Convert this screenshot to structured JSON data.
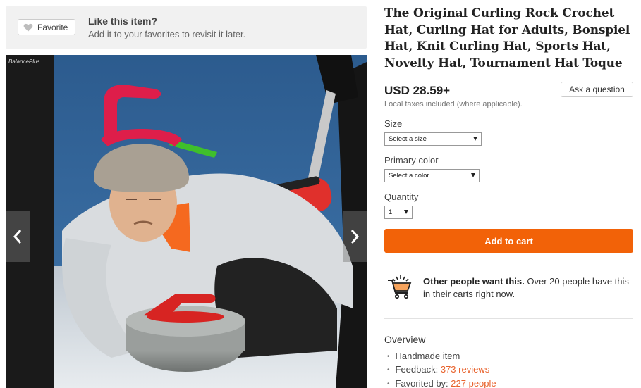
{
  "favorite": {
    "button_label": "Favorite",
    "title": "Like this item?",
    "subtitle": "Add it to your favorites to revisit it later."
  },
  "listing": {
    "title": "The Original Curling Rock Crochet Hat, Curling Hat for Adults, Bonspiel Hat, Knit Curling Hat, Sports Hat, Novelty Hat, Tournament Hat Toque",
    "price": "USD 28.59+",
    "ask_label": "Ask a question",
    "taxes_note": "Local taxes included (where applicable).",
    "image_watermark": "BalancePlus"
  },
  "options": {
    "size_label": "Size",
    "size_value": "Select a size",
    "color_label": "Primary color",
    "color_value": "Select a color",
    "quantity_label": "Quantity",
    "quantity_value": "1"
  },
  "cart": {
    "add_label": "Add to cart",
    "others_bold": "Other people want this.",
    "others_text": " Over 20 people have this in their carts right now."
  },
  "overview": {
    "title": "Overview",
    "item1": "Handmade item",
    "item2_prefix": "Feedback: ",
    "item2_link": "373 reviews",
    "item3_prefix": "Favorited by: ",
    "item3_link": "227 people"
  },
  "colors": {
    "accent": "#f26208",
    "link": "#e8622c",
    "banner_bg": "#f1f1f1"
  },
  "icons": {
    "favorite": "heart-icon",
    "prev": "chevron-left-icon",
    "next": "chevron-right-icon",
    "cart": "shopping-cart-icon"
  }
}
